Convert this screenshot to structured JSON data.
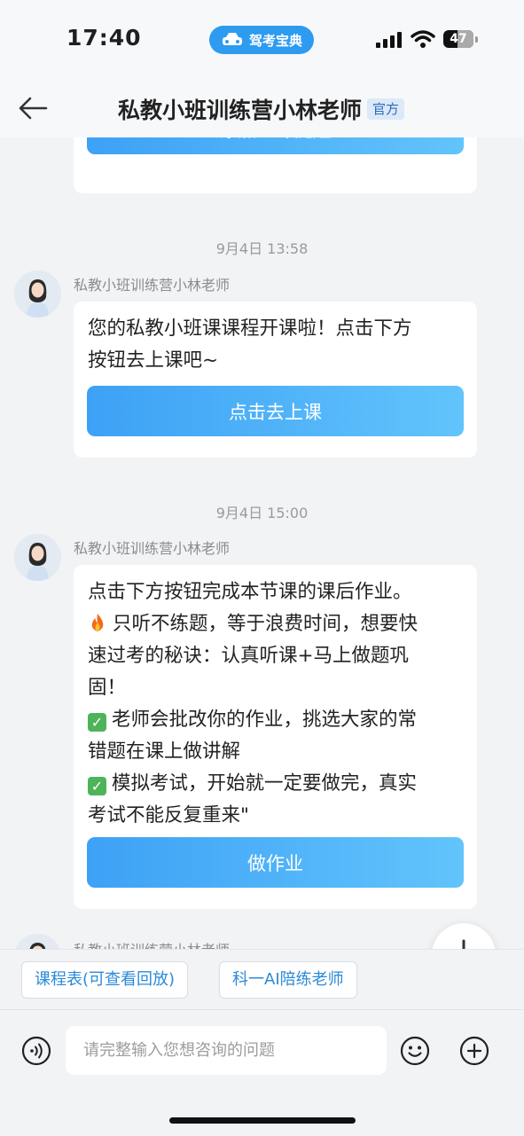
{
  "status_bar": {
    "time": "17:40",
    "app_name": "驾考宝典",
    "battery": "47",
    "battery_level": 0.47
  },
  "header": {
    "title": "私教小班训练营小林老师",
    "badge": "官方"
  },
  "messages": [
    {
      "button": "添加上课提醒"
    },
    {
      "timestamp": "9月4日 13:58",
      "sender": "私教小班训练营小林老师",
      "lines": [
        "您的私教小班课课程开课啦！点击下方",
        "按钮去上课吧~"
      ],
      "button": "点击去上课"
    },
    {
      "timestamp": "9月4日 15:00",
      "sender": "私教小班训练营小林老师",
      "lines": [
        "点击下方按钮完成本节课的课后作业。",
        "只听不练题，等于浪费时间，想要快",
        "速过考的秘诀：认真听课+马上做题巩",
        "固！",
        "老师会批改你的作业，挑选大家的常",
        "错题在课上做讲解",
        "模拟考试，开始就一定要做完，真实",
        "考试不能反复重来\""
      ],
      "button": "做作业"
    },
    {
      "sender": "私教小班训练营小林老师"
    }
  ],
  "quick_replies": [
    "课程表(可查看回放)",
    "科一AI陪练老师"
  ],
  "input": {
    "placeholder": "请完整输入您想咨询的问题"
  },
  "colors": {
    "accent": "#3da1f6",
    "app_pill": "#2d9bf0",
    "badge_bg": "#dde9f7",
    "check": "#4db45a"
  }
}
